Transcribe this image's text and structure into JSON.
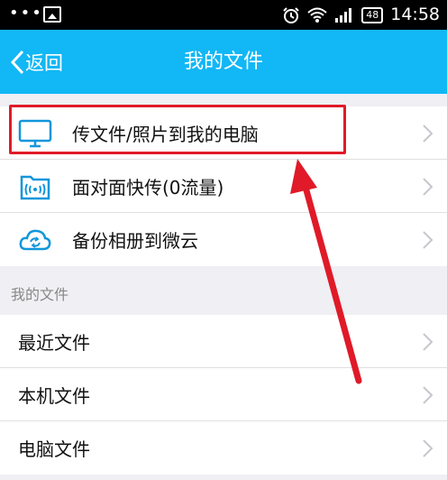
{
  "statusbar": {
    "dots": "•••",
    "battery": "48",
    "time": "14:58"
  },
  "navbar": {
    "back": "返回",
    "title": "我的文件"
  },
  "top_items": [
    {
      "label": "传文件/照片到我的电脑",
      "icon": "computer-icon"
    },
    {
      "label": "面对面快传(0流量)",
      "icon": "wifi-folder-icon"
    },
    {
      "label": "备份相册到微云",
      "icon": "cloud-sync-icon"
    }
  ],
  "section_title": "我的文件",
  "file_items": [
    {
      "label": "最近文件"
    },
    {
      "label": "本机文件"
    },
    {
      "label": "电脑文件"
    }
  ],
  "colors": {
    "accent": "#12b7f5",
    "annotation": "#e01a28",
    "icon_blue": "#1296db"
  }
}
